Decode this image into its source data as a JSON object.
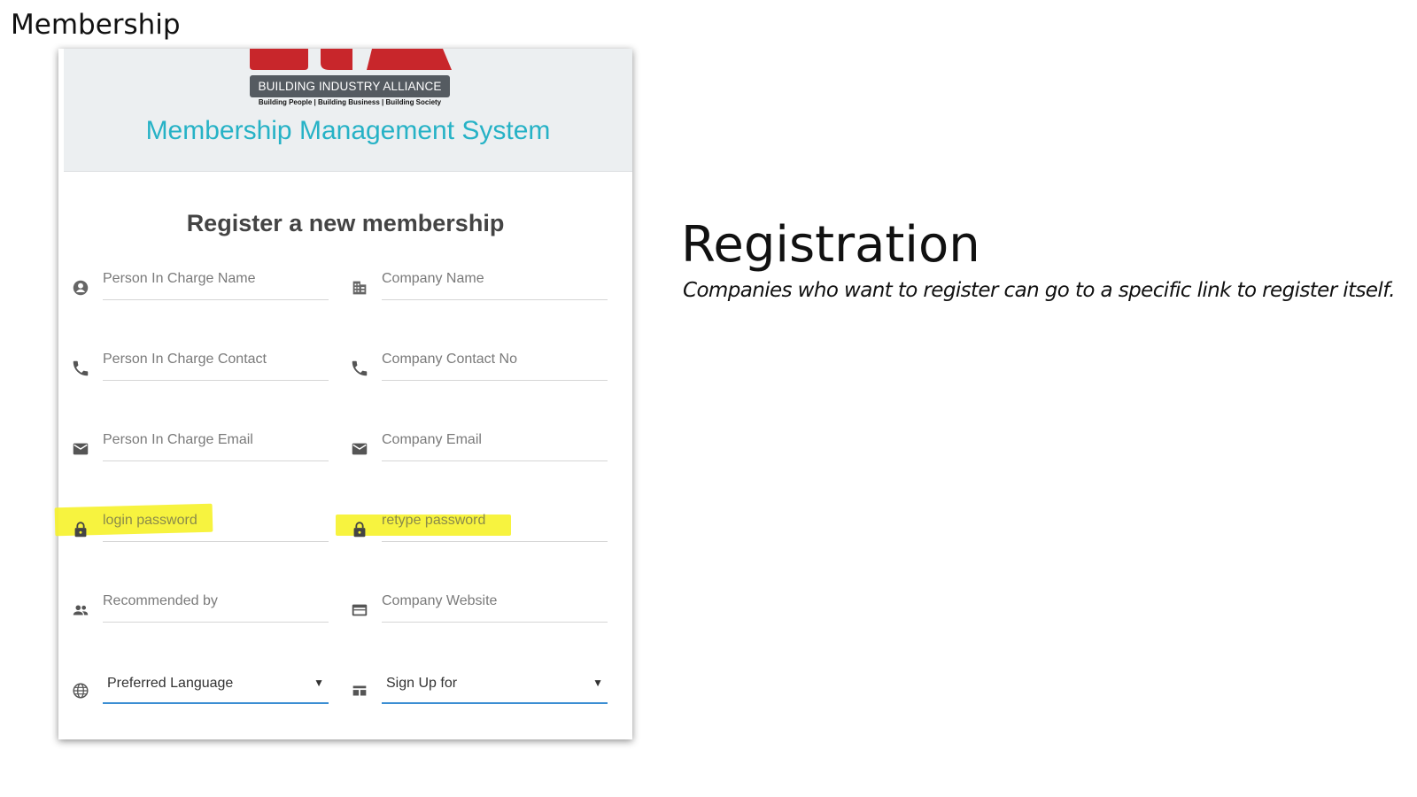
{
  "slide": {
    "title": "Membership",
    "section_title": "Registration",
    "section_description": "Companies who want to register can go to a specific link to register itself."
  },
  "header": {
    "logo_text": "BUILDING INDUSTRY ALLIANCE",
    "logo_tagline": "Building People | Building Business | Building Society",
    "system_title": "Membership Management System"
  },
  "form": {
    "heading": "Register a new membership",
    "fields": {
      "pic_name": {
        "placeholder": "Person In Charge Name",
        "icon": "account-circle-icon"
      },
      "company_name": {
        "placeholder": "Company Name",
        "icon": "building-icon"
      },
      "pic_contact": {
        "placeholder": "Person In Charge Contact",
        "icon": "phone-icon"
      },
      "company_contact": {
        "placeholder": "Company Contact No",
        "icon": "phone-icon"
      },
      "pic_email": {
        "placeholder": "Person In Charge Email",
        "icon": "mail-icon"
      },
      "company_email": {
        "placeholder": "Company Email",
        "icon": "mail-icon"
      },
      "login_password": {
        "placeholder": "login password",
        "icon": "lock-icon"
      },
      "retype_password": {
        "placeholder": "retype password",
        "icon": "lock-icon"
      },
      "recommended_by": {
        "placeholder": "Recommended by",
        "icon": "people-icon"
      },
      "company_website": {
        "placeholder": "Company Website",
        "icon": "web-icon"
      },
      "preferred_language": {
        "value": "Preferred Language",
        "icon": "globe-icon"
      },
      "sign_up_for": {
        "value": "Sign Up for",
        "icon": "list-card-icon"
      }
    }
  },
  "colors": {
    "accent": "#26b2c6",
    "select_underline": "#3b8ed3",
    "highlight": "#f6f22a",
    "logo_red": "#c8262b"
  }
}
